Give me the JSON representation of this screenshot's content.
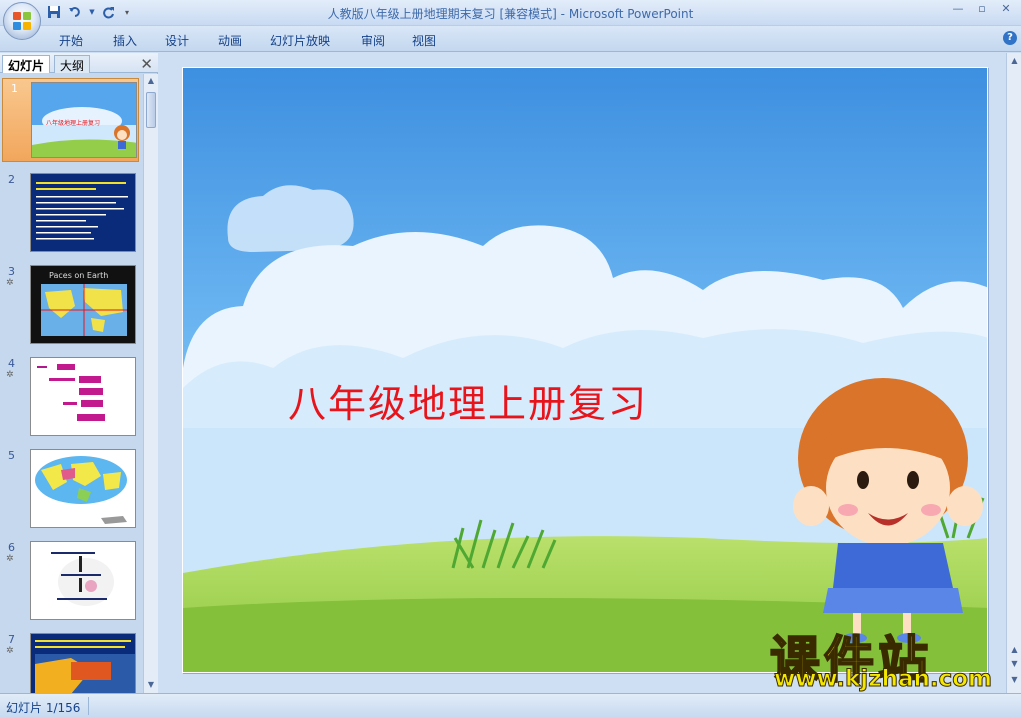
{
  "window": {
    "title": "人教版八年级上册地理期末复习 [兼容模式]",
    "separator": " - ",
    "app_name": "Microsoft PowerPoint"
  },
  "ribbon": {
    "tabs": [
      "开始",
      "插入",
      "设计",
      "动画",
      "幻灯片放映",
      "审阅",
      "视图"
    ]
  },
  "left_pane": {
    "tabs": [
      "幻灯片",
      "大纲"
    ],
    "thumbnails": [
      {
        "number": "1",
        "selected": true,
        "has_animation": false
      },
      {
        "number": "2",
        "selected": false,
        "has_animation": false
      },
      {
        "number": "3",
        "selected": false,
        "has_animation": true
      },
      {
        "number": "4",
        "selected": false,
        "has_animation": true
      },
      {
        "number": "5",
        "selected": false,
        "has_animation": false
      },
      {
        "number": "6",
        "selected": false,
        "has_animation": true
      },
      {
        "number": "7",
        "selected": false,
        "has_animation": true
      }
    ]
  },
  "slide": {
    "title": "八年级地理上册复习"
  },
  "watermark": {
    "text": "课件站",
    "url": "www.kjzhan.com"
  },
  "statusbar": {
    "slide_indicator": "幻灯片 1/156"
  },
  "colors": {
    "slide_title": "#e8141b",
    "sky_top": "#3d8fe0",
    "grass": "#8cc63f",
    "thumb_selected": "#f2a65c"
  }
}
